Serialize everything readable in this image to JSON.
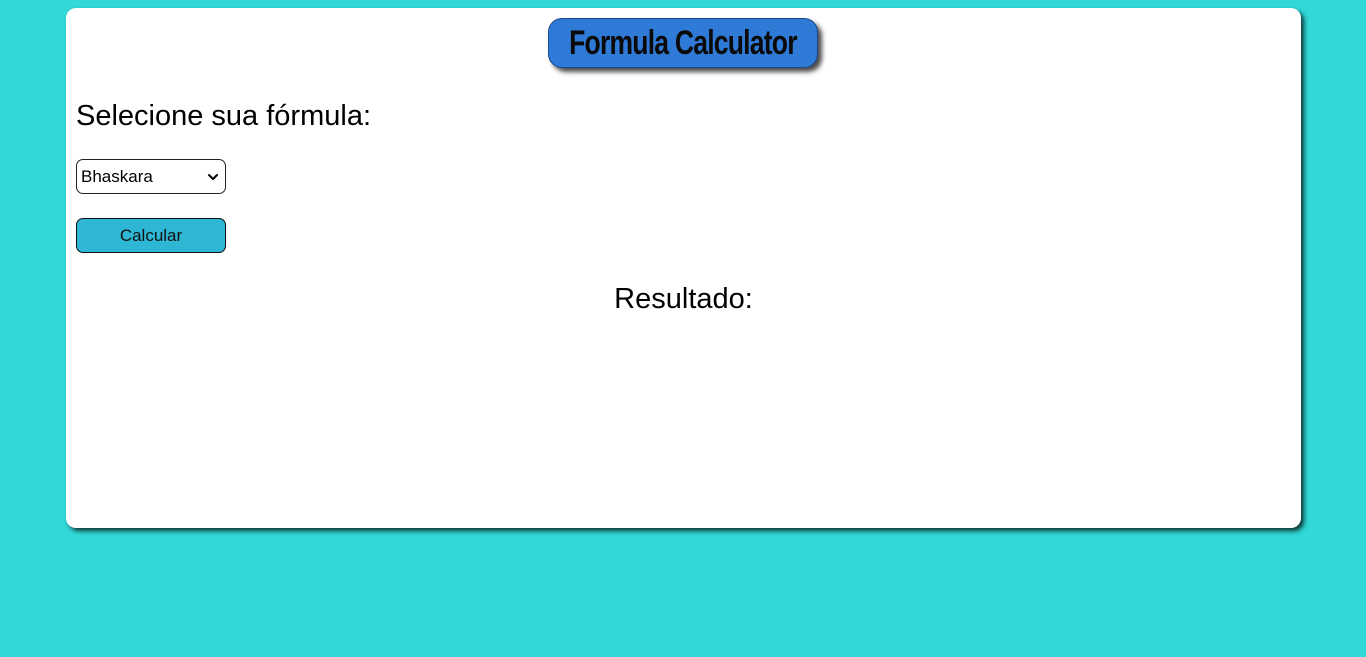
{
  "header": {
    "title": "Formula Calculator"
  },
  "form": {
    "select_heading": "Selecione sua fórmula:",
    "formula_select": {
      "selected": "Bhaskara"
    },
    "calculate_label": "Calcular"
  },
  "result": {
    "heading": "Resultado:"
  },
  "colors": {
    "page_background": "#31d8d7",
    "title_badge": "#2f7ad6",
    "calculate_button": "#2db7d4",
    "card": "#ffffff"
  },
  "icons": {
    "select_arrow": "chevron-down-icon"
  }
}
